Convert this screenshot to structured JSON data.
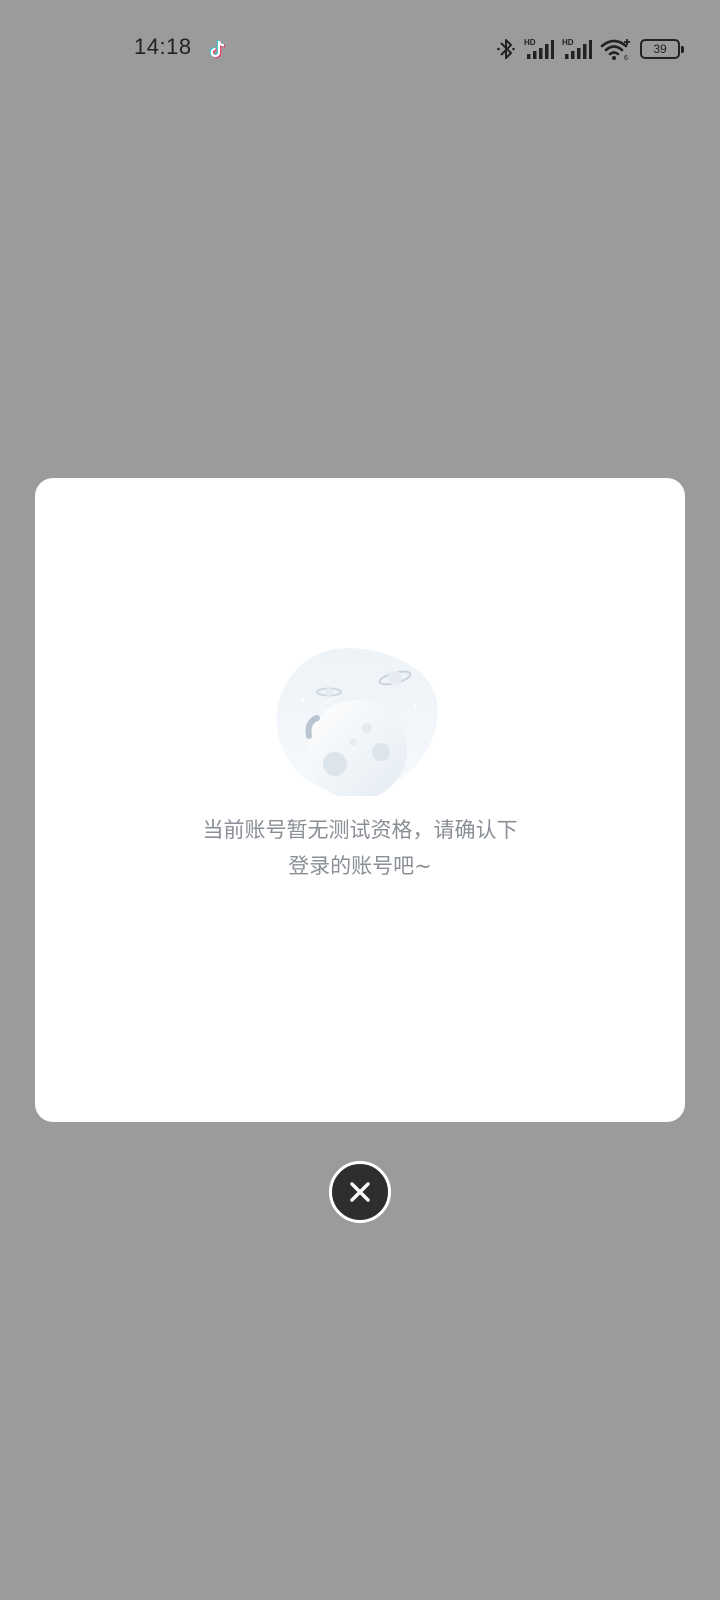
{
  "status_bar": {
    "time": "14:18",
    "notification_icon": "tiktok-icon",
    "icons": [
      "bluetooth-icon",
      "signal-hd-icon",
      "signal-hd-icon",
      "wifi-icon"
    ],
    "battery_level": "39"
  },
  "dialog": {
    "illustration": "moon-planet-illustration",
    "message_line1": "当前账号暂无测试资格，请确认下",
    "message_line2": "登录的账号吧~"
  },
  "close_button": {
    "icon": "close-icon"
  },
  "colors": {
    "overlay": "#9b9b9b",
    "dialog_bg": "#ffffff",
    "message_text": "#8a8f96",
    "close_bg": "#2e2e2e"
  }
}
